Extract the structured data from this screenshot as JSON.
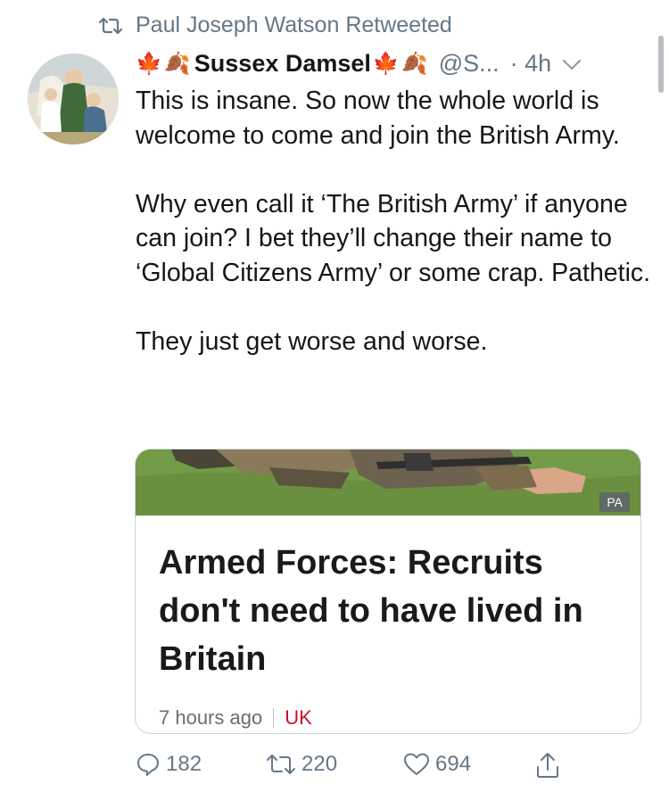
{
  "retweet": {
    "label": "Paul Joseph Watson Retweeted",
    "icon": "retweet-icon"
  },
  "tweet": {
    "leaf_left_1": "🍁",
    "leaf_left_2": "🍂",
    "display_name": "Sussex Damsel",
    "leaf_right_1": "🍁",
    "leaf_right_2": "🍂",
    "handle": "@S...",
    "time": "· 4h",
    "paragraphs": [
      "This is insane. So now the whole world is welcome to come and join the British Army.",
      "Why even call it ‘The British Army’ if anyone can join? I bet they’ll change their name to ‘Global Citizens Army’ or some crap. Pathetic.",
      "They just get worse and worse."
    ]
  },
  "card": {
    "image_badge": "PA",
    "title": "Armed Forces: Recruits don't need to have lived in Britain",
    "age": "7 hours ago",
    "section": "UK",
    "section_color": "#c8102e"
  },
  "actions": {
    "replies": "182",
    "retweets": "220",
    "likes": "694"
  },
  "colors": {
    "text": "#14171a",
    "muted": "#657786",
    "border": "#ccd6dd"
  }
}
